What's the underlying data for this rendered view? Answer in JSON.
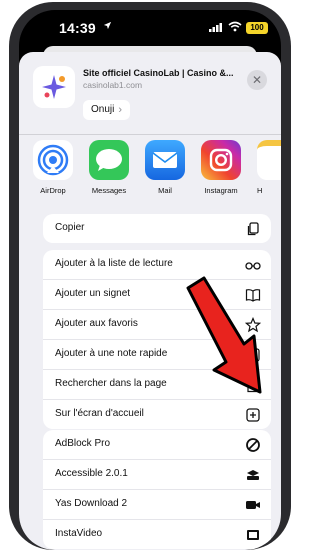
{
  "status_bar": {
    "time": "14:39",
    "battery": "100"
  },
  "header": {
    "title": "Site officiel CasinoLab | Casino &...",
    "url": "casinolab1.com",
    "options_label": "Onuji"
  },
  "apps": [
    {
      "label": "AirDrop",
      "icon": "airdrop-icon"
    },
    {
      "label": "Messages",
      "icon": "messages-icon"
    },
    {
      "label": "Mail",
      "icon": "mail-icon"
    },
    {
      "label": "Instagram",
      "icon": "instagram-icon"
    },
    {
      "label": "H",
      "icon": "notes-icon"
    }
  ],
  "actions": {
    "copy": {
      "label": "Copier",
      "icon": "copy-icon"
    },
    "group2": [
      {
        "label": "Ajouter à la liste de lecture",
        "icon": "glasses-icon"
      },
      {
        "label": "Ajouter un signet",
        "icon": "book-icon"
      },
      {
        "label": "Ajouter aux favoris",
        "icon": "star-icon"
      },
      {
        "label": "Ajouter à une note rapide",
        "icon": "quick-note-icon"
      },
      {
        "label": "Rechercher dans la page",
        "icon": "find-in-page-icon"
      },
      {
        "label": "Sur l'écran d'accueil",
        "icon": "add-square-icon"
      }
    ],
    "group3": [
      {
        "label": "AdBlock Pro",
        "icon": "adblock-icon"
      },
      {
        "label": "Accessible 2.0.1",
        "icon": "stack-icon"
      },
      {
        "label": "Yas Download 2",
        "icon": "video-icon"
      },
      {
        "label": "InstaVideo",
        "icon": "film-icon"
      }
    ]
  },
  "colors": {
    "arrow_red": "#e8231e",
    "sheet_bg": "#efeff4",
    "messages_green": "#34c759",
    "mail_blue": "#1e8cf0",
    "airdrop_blue": "#2f7cf6"
  }
}
